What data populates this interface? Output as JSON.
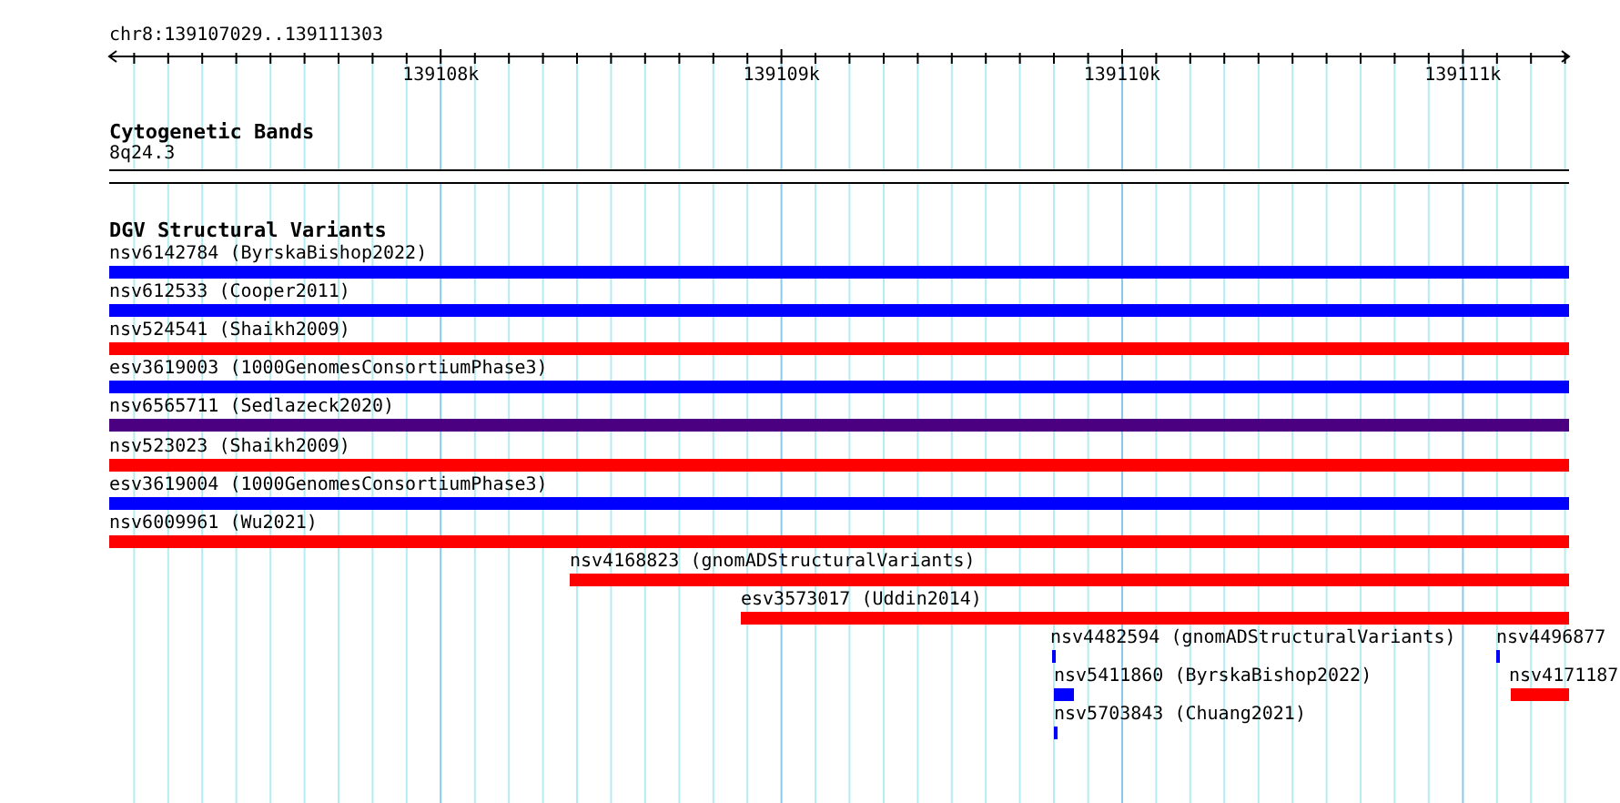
{
  "ruler": {
    "location": "chr8:139107029..139111303",
    "ticks": [
      "139108k",
      "139109k",
      "139110k",
      "139111k"
    ]
  },
  "tracks": [
    {
      "title": "Cytogenetic Bands",
      "kind": "bands",
      "features": [
        {
          "label": "8q24.3"
        }
      ]
    },
    {
      "title": "DGV Structural Variants",
      "kind": "variants",
      "features": [
        {
          "label": "nsv6142784 (ByrskaBishop2022)",
          "color": "#0000ff"
        },
        {
          "label": "nsv612533 (Cooper2011)",
          "color": "#0000ff"
        },
        {
          "label": "nsv524541 (Shaikh2009)",
          "color": "#ff0000"
        },
        {
          "label": "esv3619003 (1000GenomesConsortiumPhase3)",
          "color": "#0000ff"
        },
        {
          "label": "nsv6565711 (Sedlazeck2020)",
          "color": "#4b0082"
        },
        {
          "label": "nsv523023 (Shaikh2009)",
          "color": "#ff0000"
        },
        {
          "label": "esv3619004 (1000GenomesConsortiumPhase3)",
          "color": "#0000ff"
        },
        {
          "label": "nsv6009961 (Wu2021)",
          "color": "#ff0000"
        },
        {
          "label": "nsv4168823 (gnomADStructuralVariants)",
          "color": "#ff0000"
        },
        {
          "label": "esv3573017 (Uddin2014)",
          "color": "#ff0000"
        },
        {
          "label": "nsv4482594 (gnomADStructuralVariants)",
          "color": "#0000ff"
        },
        {
          "label": "nsv4496877",
          "color": "#0000ff"
        },
        {
          "label": "nsv5411860 (ByrskaBishop2022)",
          "color": "#0000ff"
        },
        {
          "label": "nsv4171187",
          "color": "#ff0000"
        },
        {
          "label": "nsv5703843 (Chuang2021)",
          "color": "#0000ff"
        }
      ]
    }
  ]
}
